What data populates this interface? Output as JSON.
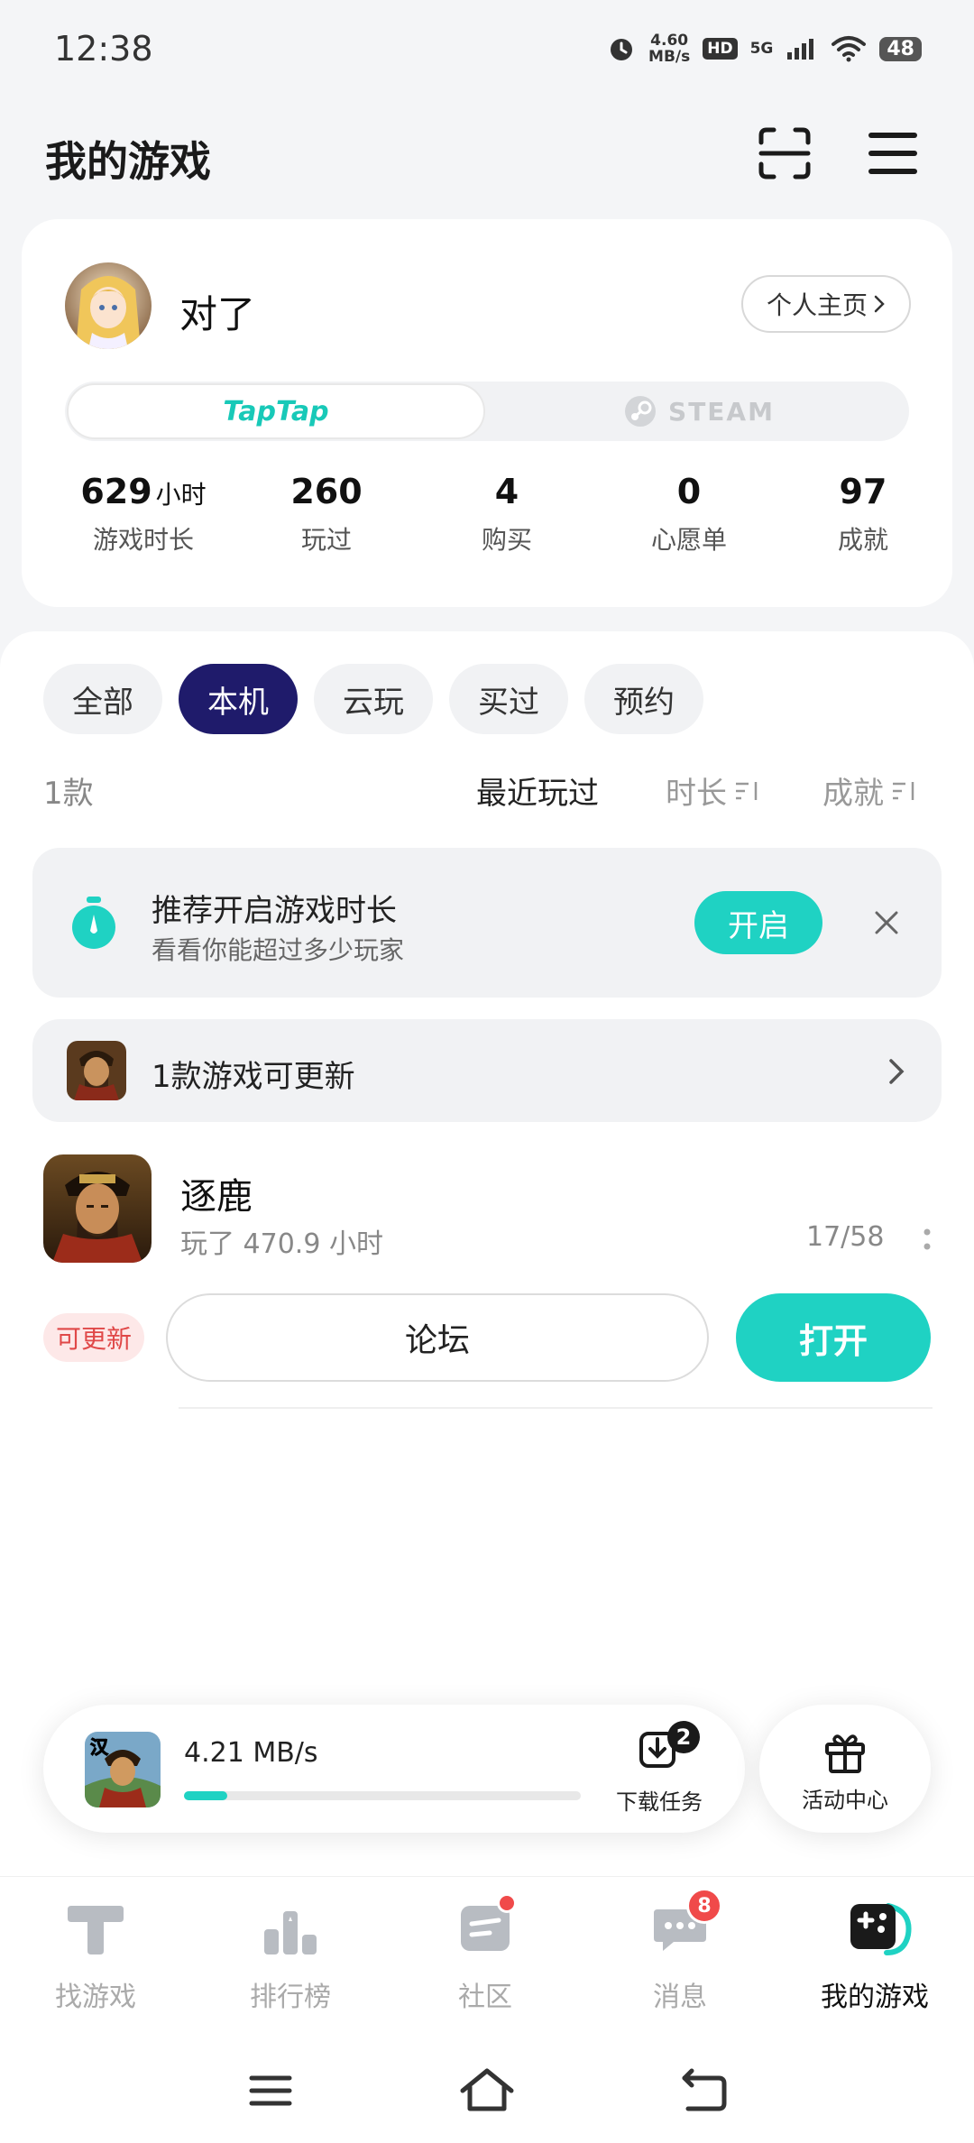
{
  "status": {
    "time": "12:38",
    "net_speed": "4.60\nMB/s",
    "hd": "HD",
    "network": "5G",
    "battery": "48"
  },
  "header": {
    "title": "我的游戏"
  },
  "profile": {
    "username": "对了",
    "homepage_label": "个人主页",
    "platforms": {
      "taptap": "TapTap",
      "steam": "STEAM"
    },
    "stats": [
      {
        "value": "629",
        "unit": "小时",
        "label": "游戏时长"
      },
      {
        "value": "260",
        "unit": "",
        "label": "玩过"
      },
      {
        "value": "4",
        "unit": "",
        "label": "购买"
      },
      {
        "value": "0",
        "unit": "",
        "label": "心愿单"
      },
      {
        "value": "97",
        "unit": "",
        "label": "成就"
      }
    ]
  },
  "filters": {
    "chips": [
      "全部",
      "本机",
      "云玩",
      "买过",
      "预约"
    ],
    "active_chip": "本机",
    "count": "1款",
    "sort": {
      "recent": "最近玩过",
      "duration": "时长",
      "achievements": "成就"
    }
  },
  "recommend": {
    "title": "推荐开启游戏时长",
    "subtitle": "看看你能超过多少玩家",
    "button": "开启"
  },
  "update_bar": {
    "text": "1款游戏可更新"
  },
  "game": {
    "name": "逐鹿",
    "playtime": "玩了 470.9 小时",
    "achievements": "17/58",
    "update_badge": "可更新",
    "forum_label": "论坛",
    "open_label": "打开"
  },
  "download": {
    "speed": "4.21 MB/s",
    "progress": 0.11,
    "task_label": "下载任务",
    "task_count": "2",
    "thumb_char": "汉",
    "activity_label": "活动中心"
  },
  "nav": {
    "items": [
      {
        "label": "找游戏"
      },
      {
        "label": "排行榜"
      },
      {
        "label": "社区"
      },
      {
        "label": "消息",
        "badge": "8"
      },
      {
        "label": "我的游戏"
      }
    ]
  },
  "colors": {
    "accent": "#1fd2c3",
    "chip_active": "#1f1b6b",
    "badge_red": "#f04a4a",
    "background": "#f4f5f7"
  }
}
